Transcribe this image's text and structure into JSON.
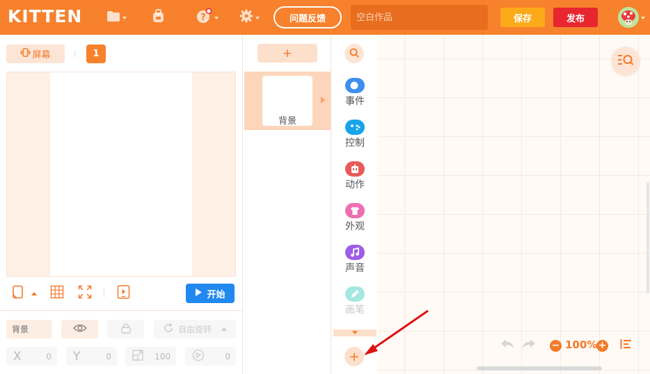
{
  "header": {
    "logo": "KITTEN",
    "feedback_label": "问题反馈",
    "title_placeholder": "空白作品",
    "save_label": "保存",
    "publish_label": "发布",
    "icons": [
      "folder-icon",
      "backpack-icon",
      "help-icon",
      "settings-icon"
    ],
    "accent_color": "#f7812c"
  },
  "stage": {
    "screen_label": "屏幕",
    "page_number": "1",
    "start_label": "开始",
    "tools": [
      "phone-orientation-icon",
      "grid-icon",
      "fullscreen-icon",
      "device-preview-icon"
    ]
  },
  "properties": {
    "name": "背景",
    "rotation_label": "自由旋转",
    "x_label": "X",
    "x_value": "0",
    "y_label": "Y",
    "y_value": "0",
    "scale_value": "100",
    "direction_value": "0"
  },
  "sprites": {
    "add_label": "+",
    "items": [
      {
        "label": "背景"
      }
    ]
  },
  "categories": {
    "items": [
      {
        "label": "事件",
        "color": "#3d8ff0",
        "icon": "toggle-icon"
      },
      {
        "label": "控制",
        "color": "#17a4e8",
        "icon": "gamepad-icon"
      },
      {
        "label": "动作",
        "color": "#e85a5a",
        "icon": "robot-icon"
      },
      {
        "label": "外观",
        "color": "#ee6fb1",
        "icon": "shirt-icon"
      },
      {
        "label": "声音",
        "color": "#9f5ce6",
        "icon": "music-icon"
      },
      {
        "label": "画笔",
        "color": "#5fd4c5",
        "icon": "pen-icon"
      }
    ],
    "add_label": "+"
  },
  "workspace": {
    "zoom": "100%"
  }
}
